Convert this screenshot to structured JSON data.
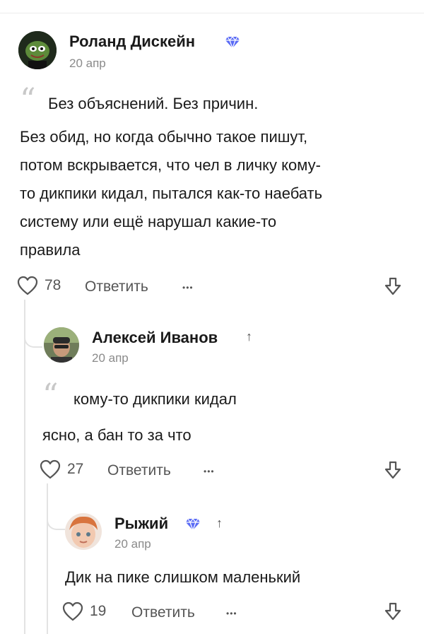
{
  "comments": [
    {
      "author": "Роланд Дискейн",
      "date": "20 апр",
      "verified": true,
      "quote": "Без объяснений. Без причин.",
      "text_lines": [
        "Без обид, но когда обычно такое пишут,",
        "потом вскрывается, что чел в личку кому-",
        "то дикпики кидал, пытался как-то наебать",
        "систему или ещё нарушал какие-то",
        "правила"
      ],
      "likes": "78",
      "reply_label": "Ответить",
      "more_label": "•••"
    },
    {
      "author": "Алексей Иванов",
      "date": "20 апр",
      "verified": false,
      "arrow": "↑",
      "quote": "кому-то дикпики кидал",
      "text_lines": [
        "ясно, а бан то за что"
      ],
      "likes": "27",
      "reply_label": "Ответить",
      "more_label": "•••"
    },
    {
      "author": "Рыжий",
      "date": "20 апр",
      "verified": true,
      "arrow": "↑",
      "text_lines": [
        "Дик на пике слишком маленький"
      ],
      "likes": "19",
      "reply_label": "Ответить",
      "more_label": "•••"
    }
  ],
  "colors": {
    "verified": "#5a6bf5",
    "text": "#1a1a1a",
    "muted": "#8a8a8a",
    "thread": "#e3e3e3"
  }
}
